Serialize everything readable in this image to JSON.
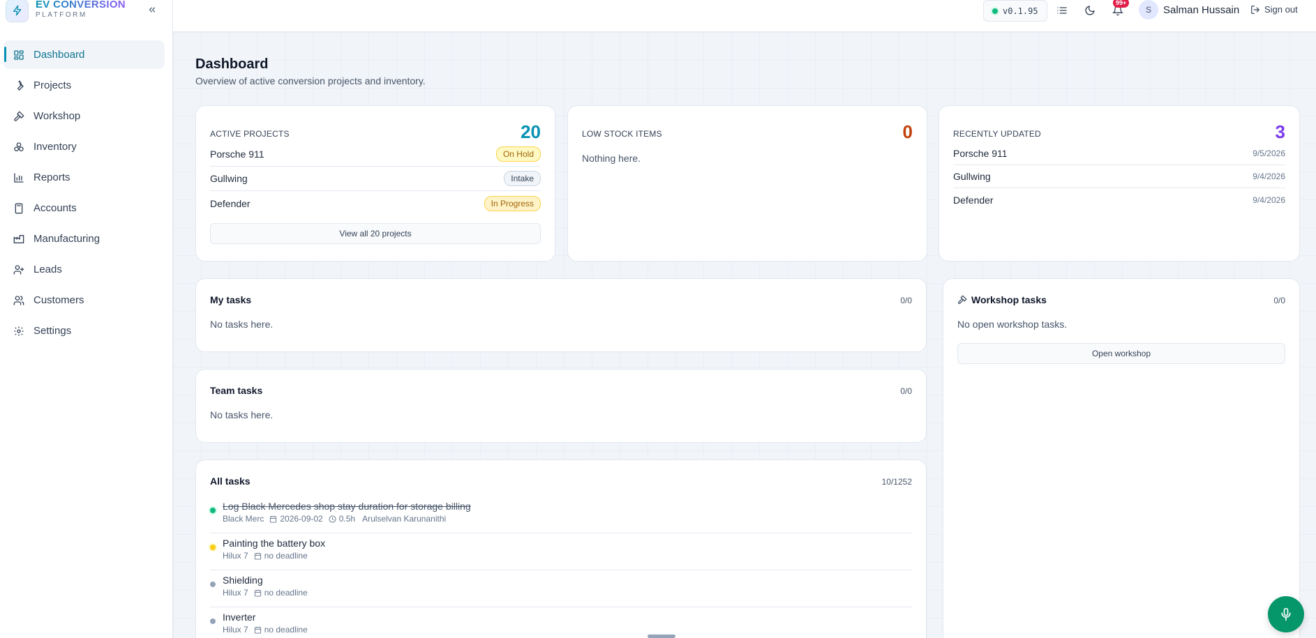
{
  "brand": {
    "title": "EV CONVERSION",
    "subtitle": "PLATFORM"
  },
  "sidebar": {
    "items": [
      {
        "label": "Dashboard",
        "icon": "dashboard-icon",
        "active": true
      },
      {
        "label": "Projects",
        "icon": "wrench-icon"
      },
      {
        "label": "Workshop",
        "icon": "hammer-icon"
      },
      {
        "label": "Inventory",
        "icon": "boxes-icon"
      },
      {
        "label": "Reports",
        "icon": "bar-chart-icon"
      },
      {
        "label": "Accounts",
        "icon": "calculator-icon"
      },
      {
        "label": "Manufacturing",
        "icon": "factory-icon"
      },
      {
        "label": "Leads",
        "icon": "user-plus-icon"
      },
      {
        "label": "Customers",
        "icon": "users-icon"
      },
      {
        "label": "Settings",
        "icon": "gear-icon"
      }
    ]
  },
  "topbar": {
    "version": "v0.1.95",
    "notifications_badge": "99+",
    "avatar_initial": "S",
    "user_name": "Salman Hussain",
    "signout_label": "Sign out"
  },
  "page": {
    "title": "Dashboard",
    "subtitle": "Overview of active conversion projects and inventory."
  },
  "active_projects": {
    "label": "ACTIVE PROJECTS",
    "count": "20",
    "color": "#0891b2",
    "rows": [
      {
        "name": "Porsche 911",
        "status": "On Hold"
      },
      {
        "name": "Gullwing",
        "status": "Intake"
      },
      {
        "name": "Defender",
        "status": "In Progress"
      }
    ],
    "view_all": "View all 20 projects"
  },
  "low_stock": {
    "label": "LOW STOCK ITEMS",
    "count": "0",
    "color": "#c2410c",
    "empty": "Nothing here."
  },
  "recently_updated": {
    "label": "RECENTLY UPDATED",
    "count": "3",
    "color": "#7c3aed",
    "rows": [
      {
        "name": "Porsche 911",
        "date": "9/5/2026"
      },
      {
        "name": "Gullwing",
        "date": "9/4/2026"
      },
      {
        "name": "Defender",
        "date": "9/4/2026"
      }
    ]
  },
  "my_tasks": {
    "title": "My tasks",
    "count": "0/0",
    "empty": "No tasks here."
  },
  "team_tasks": {
    "title": "Team tasks",
    "count": "0/0",
    "empty": "No tasks here."
  },
  "workshop_tasks": {
    "title": "Workshop tasks",
    "count": "0/0",
    "empty": "No open workshop tasks.",
    "button": "Open workshop"
  },
  "all_tasks": {
    "title": "All tasks",
    "count": "10/1252",
    "items": [
      {
        "title": "Log Black Mercedes shop stay duration for storage billing",
        "done": true,
        "project": "Black Merc",
        "date": "2026-09-02",
        "hours": "0.5h",
        "assignee": "Arulselvan Karunanithi",
        "status_color": "#10b981"
      },
      {
        "title": "Painting the battery box",
        "done": false,
        "project": "Hilux 7",
        "date": "no deadline",
        "status_color": "#facc15"
      },
      {
        "title": "Shielding",
        "done": false,
        "project": "Hilux 7",
        "date": "no deadline",
        "status_color": "#94a3b8"
      },
      {
        "title": "Inverter",
        "done": false,
        "project": "Hilux 7",
        "date": "no deadline",
        "status_color": "#94a3b8"
      }
    ]
  }
}
